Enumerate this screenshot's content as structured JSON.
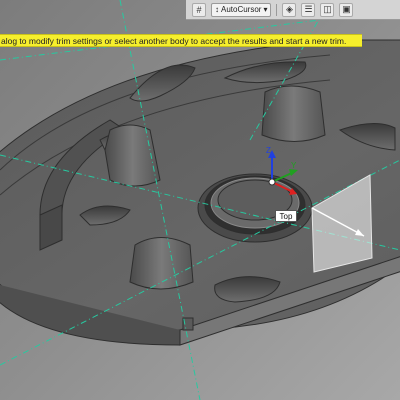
{
  "toolbar": {
    "select_value": "AutoCursor",
    "icons": [
      "grid-icon",
      "snap-icon",
      "cursor-mode-icon",
      "layers-icon",
      "split-view-icon",
      "display-mode-icon"
    ]
  },
  "hint": {
    "text": "alog to modify trim settings or select another body to accept the results and start a new trim."
  },
  "viewcube": {
    "label": "Top"
  },
  "colors": {
    "hint_background": "#f6ef2c",
    "axis_x": "#e02020",
    "axis_y": "#20a020",
    "axis_z": "#2040e0",
    "guide_line": "#27c9a0"
  }
}
